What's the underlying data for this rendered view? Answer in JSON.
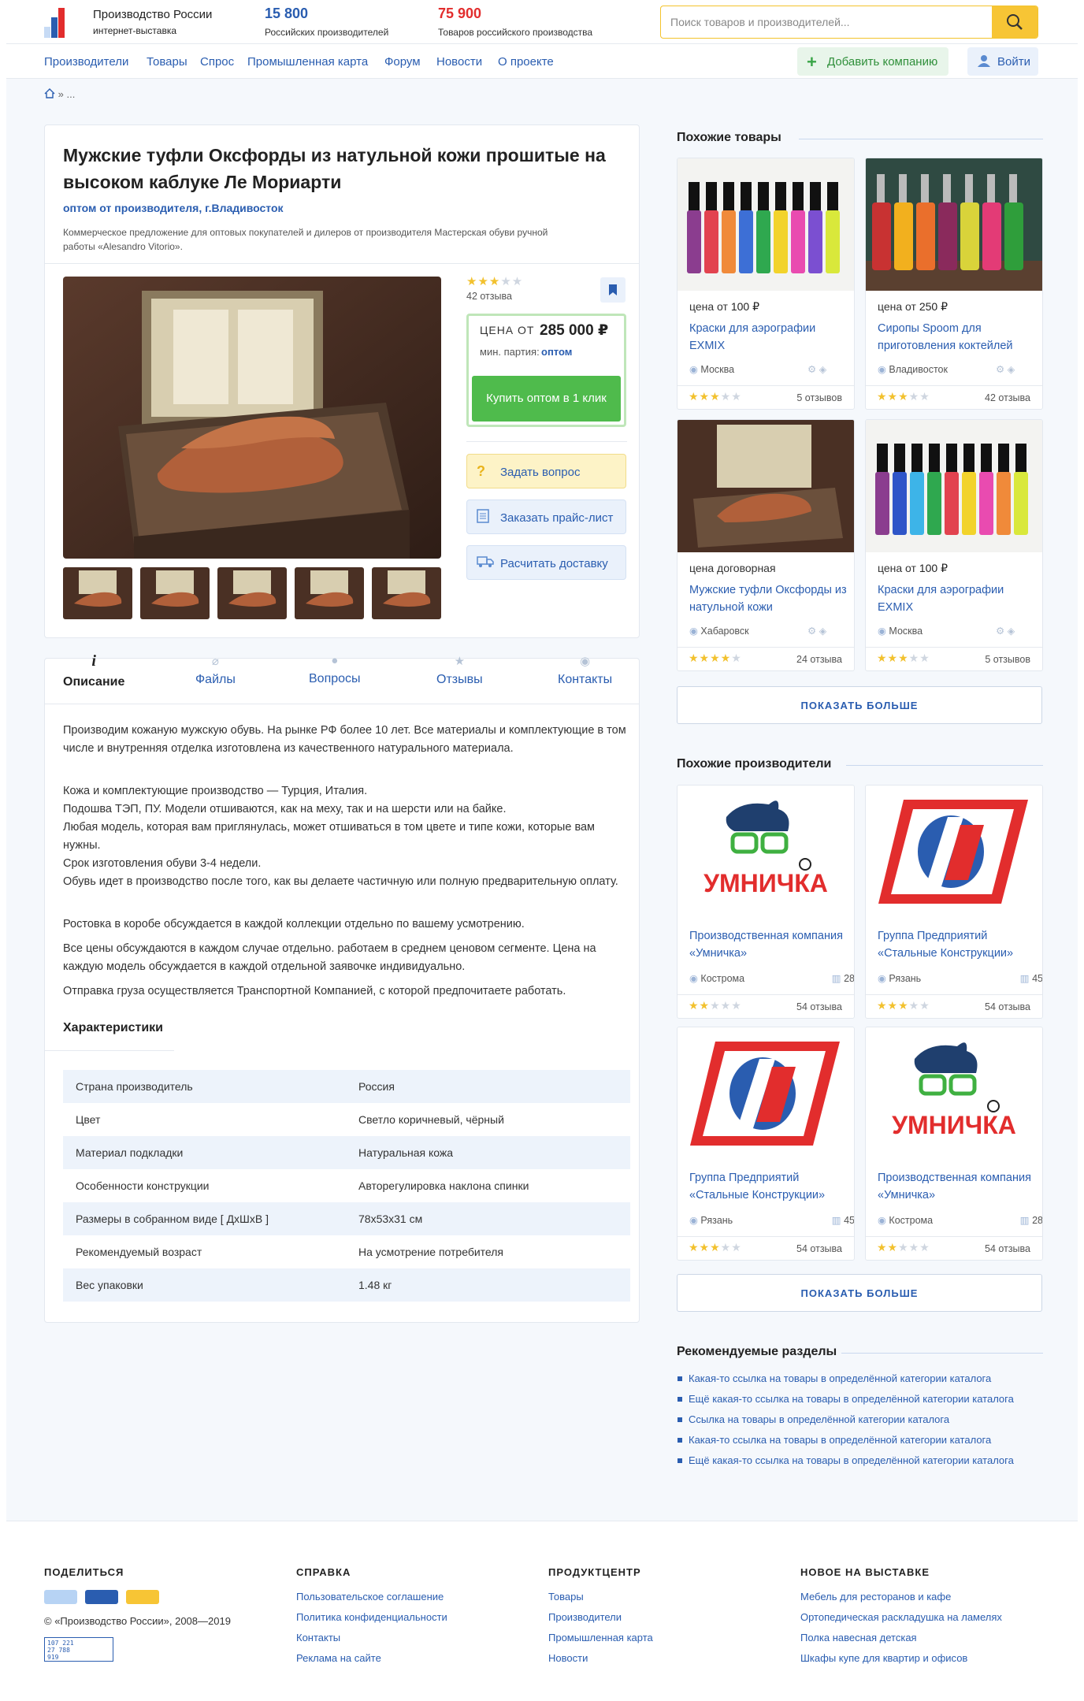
{
  "header": {
    "logo_title": "Производство России",
    "logo_subtitle": "интернет-выставка",
    "stat1_value": "15 800",
    "stat1_label": "Российских производителей",
    "stat2_value": "75 900",
    "stat2_label": "Товаров российского производства",
    "search_placeholder": "Поиск товаров и производителей...",
    "colors": {
      "accent": "#2a5db0",
      "stat2": "#e22d2d",
      "search_button": "#f7c535"
    }
  },
  "nav": {
    "items": [
      "Производители",
      "Товары",
      "Спрос",
      "Промышленная карта",
      "Форум",
      "Новости",
      "О проекте"
    ],
    "add_company": "Добавить компанию",
    "login": "Войти"
  },
  "breadcrumb": "»  ...",
  "product": {
    "title": "Мужские туфли Оксфорды из натульной кожи прошитые на высоком каблуке Ле Мориарти",
    "subtitle": "оптом от производителя, г.Владивосток",
    "description": "Коммерческое предложение для оптовых покупателей и дилеров от производителя Мастерская обуви ручной работы «Alesandro Vitorio».",
    "rating": 3,
    "reviews": "42 отзыва",
    "price_prefix": "ЦЕНА ОТ",
    "price_value": "285 000 ₽",
    "min_batch_label": "мин. партия:",
    "min_batch_value": "оптом",
    "buy_button": "Купить оптом в 1 клик",
    "ask_button": "Задать вопрос",
    "pricelist_button": "Заказать прайс-лист",
    "delivery_button": "Расчитать доставку"
  },
  "tabs": [
    "Описание",
    "Файлы",
    "Вопросы",
    "Отзывы",
    "Контакты"
  ],
  "description_paragraphs": [
    "Производим кожаную мужскую обувь. На рынке РФ более 10 лет. Все материалы и комплектующие в том числе и внутренняя отделка изготовлена из качественного натурального материала.",
    "Кожа и комплектующие производство — Турция, Италия.\nПодошва ТЭП, ПУ. Модели отшиваются, как на меху, так и на шерсти или на байке.\nЛюбая модель, которая вам приглянулась, может отшиваться в том цвете и типе кожи, которые вам нужны.\nСрок изготовления обуви 3-4 недели.\nОбувь идет в производство после того, как вы делаете частичную или полную предварительную оплату.",
    "Ростовка в коробе обсуждается в каждой коллекции отдельно по вашему усмотрению.",
    "Все цены обсуждаются в каждом случае отдельно. работаем в среднем ценовом сегменте. Цена на каждую модель обсуждается в каждой отдельной заявочке индивидуально.",
    "Отправка груза осуществляется Транспортной Компанией, с которой предпочитаете работать."
  ],
  "characteristics_title": "Характеристики",
  "characteristics": [
    [
      "Страна производитель",
      "Россия"
    ],
    [
      "Цвет",
      "Светло коричневый, чёрный"
    ],
    [
      "Материал подкладки",
      "Натуральная кожа"
    ],
    [
      "Особенности конструкции",
      "Авторегулировка наклона спинки"
    ],
    [
      "Размеры в собранном виде [ ДхШхВ ]",
      "78х53х31 см"
    ],
    [
      "Рекомендуемый возраст",
      "На усмотрение потребителя"
    ],
    [
      "Вес упаковки",
      "1.48 кг"
    ]
  ],
  "similar_products_title": "Похожие товары",
  "similar_products": [
    {
      "price_label": "цена от",
      "price": "100 ₽",
      "name": "Краски для аэрографии EXMIX",
      "city": "Москва",
      "rating": 3,
      "reviews": "5 отзывов",
      "image": "paints"
    },
    {
      "price_label": "цена от",
      "price": "250 ₽",
      "name": "Сиропы Spoom для приготовления коктейлей",
      "city": "Владивосток",
      "rating": 3,
      "reviews": "42 отзыва",
      "image": "syrups"
    },
    {
      "price_label": "цена договорная",
      "price": "",
      "name": "Мужские туфли Оксфорды из натульной кожи",
      "city": "Хабаровск",
      "rating": 4,
      "reviews": "24 отзыва",
      "image": "shoe"
    },
    {
      "price_label": "цена от",
      "price": "100 ₽",
      "name": "Краски для аэрографии EXMIX",
      "city": "Москва",
      "rating": 3,
      "reviews": "5 отзывов",
      "image": "paints"
    }
  ],
  "show_more": "ПОКАЗАТЬ БОЛЬШЕ",
  "similar_makers_title": "Похожие производители",
  "similar_makers": [
    {
      "name": "Производственная компания «Умничка»",
      "city": "Кострома",
      "count": "28",
      "rating": 2,
      "reviews": "54 отзыва",
      "logo": "umnichka"
    },
    {
      "name": "Группа Предприятий «Стальные Конструкции»",
      "city": "Рязань",
      "count": "45",
      "rating": 3,
      "reviews": "54 отзыва",
      "logo": "steel"
    },
    {
      "name": "Группа Предприятий «Стальные Конструкции»",
      "city": "Рязань",
      "count": "45",
      "rating": 3,
      "reviews": "54 отзыва",
      "logo": "steel"
    },
    {
      "name": "Производственная компания «Умничка»",
      "city": "Кострома",
      "count": "28",
      "rating": 2,
      "reviews": "54 отзыва",
      "logo": "umnichka"
    }
  ],
  "umnichka_logo_text": "УМНИЧКА",
  "recommended_title": "Рекомендуемые разделы",
  "recommended": [
    "Какая-то ссылка на товары в определённой категории каталога",
    "Ещё какая-то ссылка на товары в определённой категории каталога",
    "Ссылка на товары в определённой категории каталога",
    "Какая-то ссылка на товары в определённой категории каталога",
    "Ещё какая-то ссылка на товары в определённой категории каталога"
  ],
  "footer": {
    "share_title": "ПОДЕЛИТЬСЯ",
    "copyright": "© «Производство России», 2008—2019",
    "counter": [
      "107 221",
      "27 788",
      "919"
    ],
    "help_title": "СПРАВКА",
    "help_links": [
      "Пользовательское соглашение",
      "Политика конфиденциальности",
      "Контакты",
      "Реклама на сайте"
    ],
    "product_title": "ПРОДУКТЦЕНТР",
    "product_links": [
      "Товары",
      "Производители",
      "Промышленная карта",
      "Новости"
    ],
    "new_title": "НОВОЕ НА ВЫСТАВКЕ",
    "new_links": [
      "Мебель для ресторанов и кафе",
      "Ортопедическая раскладушка на ламелях",
      "Полка навесная детская",
      "Шкафы купе для квартир и офисов"
    ]
  }
}
